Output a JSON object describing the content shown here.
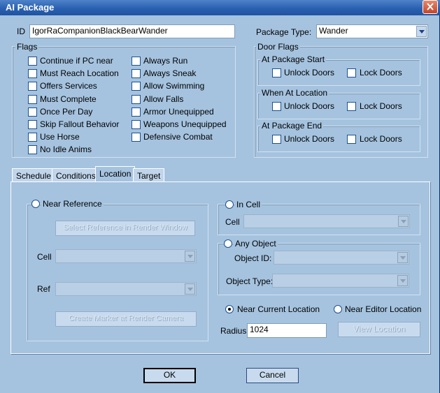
{
  "window": {
    "title": "AI Package"
  },
  "id_field": {
    "label": "ID",
    "value": "IgorRaCompanionBlackBearWander"
  },
  "package_type": {
    "label": "Package Type:",
    "value": "Wander"
  },
  "flags": {
    "label": "Flags",
    "left": [
      "Continue if PC near",
      "Must Reach Location",
      "Offers Services",
      "Must Complete",
      "Once Per Day",
      "Skip Fallout Behavior",
      "Use Horse",
      "No Idle Anims"
    ],
    "right": [
      "Always Run",
      "Always Sneak",
      "Allow Swimming",
      "Allow Falls",
      "Armor Unequipped",
      "Weapons Unequipped",
      "Defensive Combat"
    ]
  },
  "door_flags": {
    "label": "Door Flags",
    "groups": [
      {
        "label": "At Package Start",
        "unlock": "Unlock Doors",
        "lock": "Lock Doors"
      },
      {
        "label": "When At Location",
        "unlock": "Unlock Doors",
        "lock": "Lock Doors"
      },
      {
        "label": "At Package End",
        "unlock": "Unlock Doors",
        "lock": "Lock Doors"
      }
    ]
  },
  "tabs": [
    "Schedule",
    "Conditions",
    "Location",
    "Target"
  ],
  "location": {
    "near_reference": {
      "label": "Near Reference",
      "select_button": "Select Reference in Render Window",
      "cell_label": "Cell",
      "ref_label": "Ref",
      "create_button": "Create Marker at Render Camera"
    },
    "in_cell": {
      "label": "In Cell",
      "cell_label": "Cell"
    },
    "any_object": {
      "label": "Any Object",
      "object_id_label": "Object ID:",
      "object_type_label": "Object Type:"
    },
    "near_current": "Near Current Location",
    "near_editor": "Near Editor Location",
    "radius_label": "Radius",
    "radius_value": "1024",
    "view_button": "View Location"
  },
  "buttons": {
    "ok": "OK",
    "cancel": "Cancel"
  },
  "colors": {
    "background": "#a5c3df",
    "titlebar": "#2a60b0",
    "close": "#c2452a"
  }
}
